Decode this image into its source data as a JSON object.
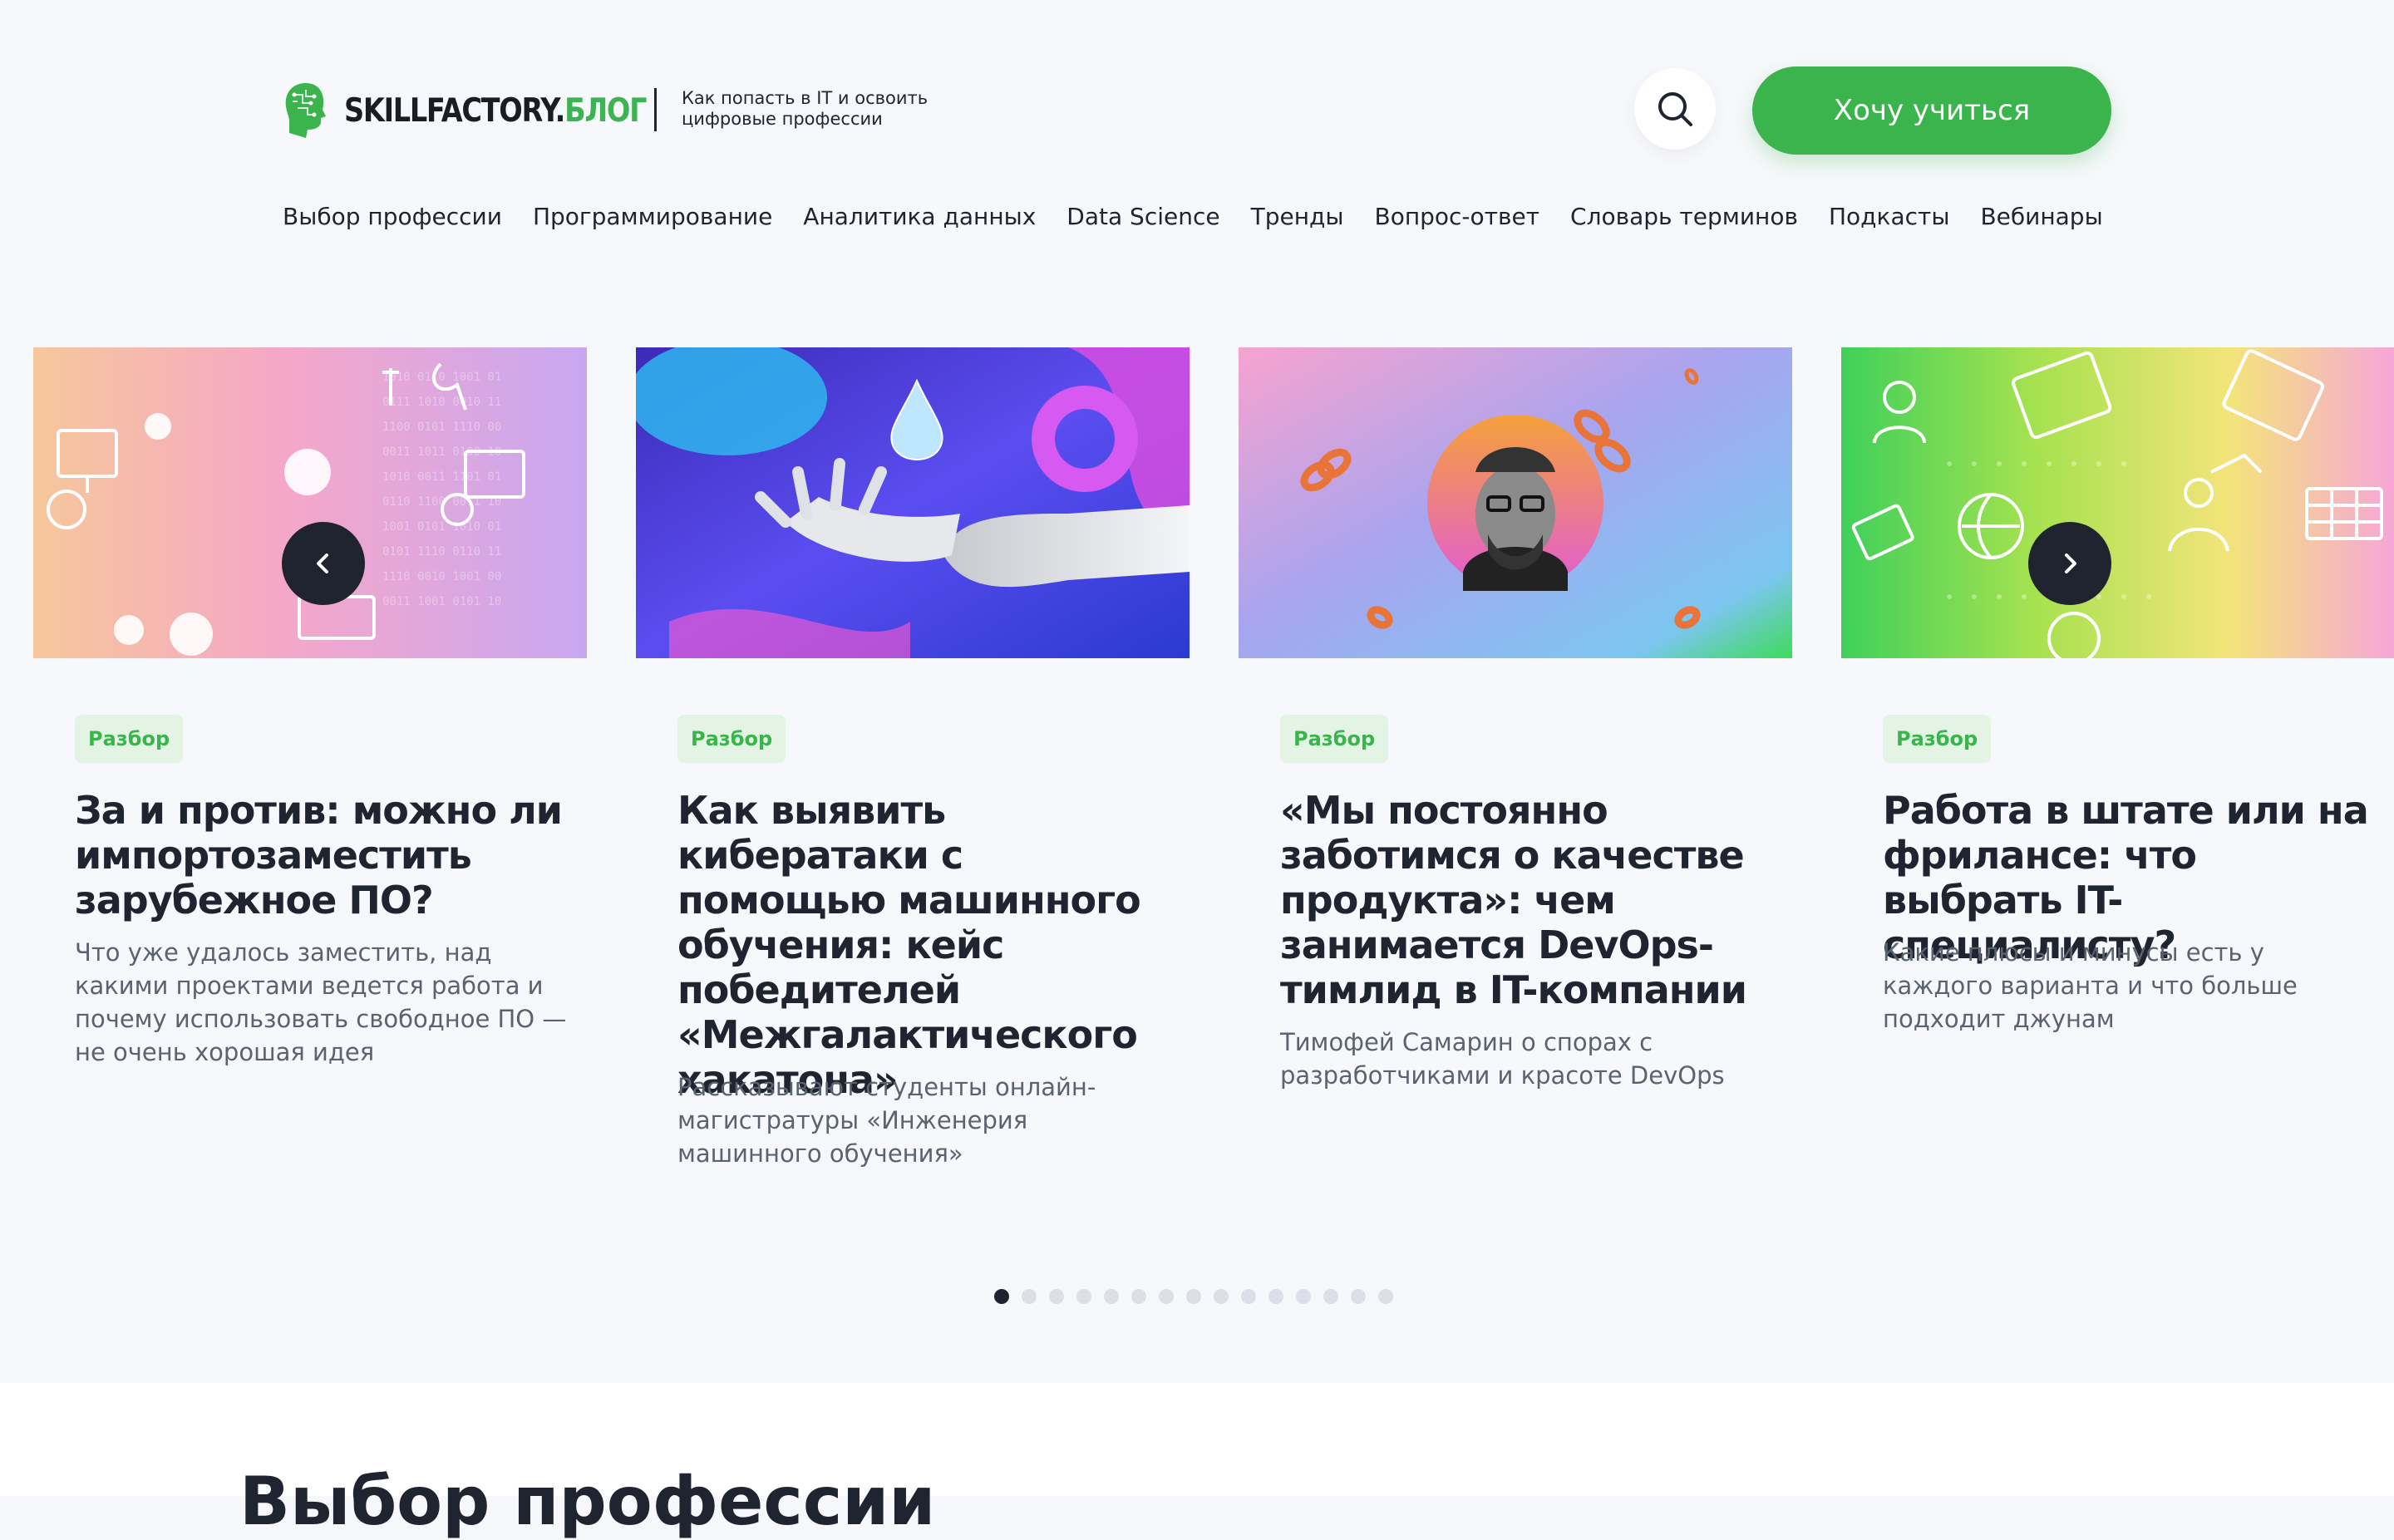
{
  "header": {
    "logo_text_part1": "SKILLFACTORY.",
    "logo_text_part2": "БЛОГ",
    "tagline_line1": "Как попасть в IT и освоить",
    "tagline_line2": "цифровые профессии",
    "cta_label": "Хочу учиться"
  },
  "nav": [
    "Выбор профессии",
    "Программирование",
    "Аналитика данных",
    "Data Science",
    "Тренды",
    "Вопрос-ответ",
    "Словарь терминов",
    "Подкасты",
    "Вебинары"
  ],
  "cards": [
    {
      "tag": "Разбор",
      "title": "За и против: можно ли импортозаместить зарубежное ПО?",
      "desc": "Что уже удалось заместить, над какими проектами ведется работа и почему использовать свободное ПО — не очень хорошая идея"
    },
    {
      "tag": "Разбор",
      "title": "Как выявить кибератаки с помощью машинного обучения: кейс победителей «Межгалактического хакатона»",
      "desc": "Рассказывают студенты онлайн-магистратуры «Инженерия машинного обучения»"
    },
    {
      "tag": "Разбор",
      "title": "«Мы постоянно заботимся о качестве продукта»: чем занимается DevOps-тимлид в IT-компании",
      "desc": "Тимофей Самарин о спорах с разработчиками и красоте DevOps"
    },
    {
      "tag": "Разбор",
      "title": "Работа в штате или на фрилансе: что выбрать IT-специалисту?",
      "desc": "Какие плюсы и минусы есть у каждого варианта и что больше подходит джунам"
    }
  ],
  "carousel": {
    "total_slides": 15,
    "active_slide": 1
  },
  "section": {
    "title": "Выбор профессии"
  },
  "colors": {
    "accent": "#3cb44e",
    "dark": "#1f2430",
    "background": "#f7f8fb"
  }
}
